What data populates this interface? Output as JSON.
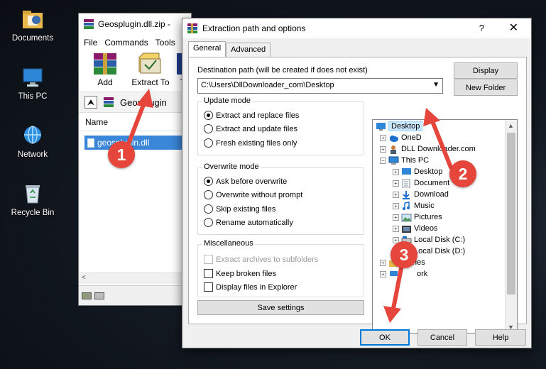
{
  "desktop": {
    "icons": [
      {
        "label": "Documents"
      },
      {
        "label": "This PC"
      },
      {
        "label": "Network"
      },
      {
        "label": "Recycle Bin"
      }
    ]
  },
  "winrar": {
    "title": "Geosplugin.dll.zip - ",
    "menu": [
      "File",
      "Commands",
      "Tools"
    ],
    "toolbar": {
      "add": "Add",
      "extract_to": "Extract To",
      "third": "T"
    },
    "address": "Geosplugin",
    "list_header": "Name",
    "selected_file": "geosplugin.dll"
  },
  "dialog": {
    "title": "Extraction path and options",
    "help": "?",
    "close": "✕",
    "tabs": [
      "General",
      "Advanced"
    ],
    "destination_label": "Destination path (will be created if does not exist)",
    "destination_value": "C:\\Users\\DllDownloader_com\\Desktop",
    "display_btn": "Display",
    "new_folder_btn": "New Folder",
    "update_mode": {
      "title": "Update mode",
      "options": [
        "Extract and replace files",
        "Extract and update files",
        "Fresh existing files only"
      ],
      "selected": 0
    },
    "overwrite_mode": {
      "title": "Overwrite mode",
      "options": [
        "Ask before overwrite",
        "Overwrite without prompt",
        "Skip existing files",
        "Rename automatically"
      ],
      "selected": 0
    },
    "misc": {
      "title": "Miscellaneous",
      "options": [
        "Extract archives to subfolders",
        "Keep broken files",
        "Display files in Explorer"
      ]
    },
    "save_settings": "Save settings",
    "tree": {
      "items": [
        {
          "label": "Desktop",
          "icon": "desktop-icon",
          "selected": true
        },
        {
          "label": "OneD",
          "icon": "onedrive-icon"
        },
        {
          "label": "DLL Downloader.com",
          "icon": "user-icon"
        },
        {
          "label": "This PC",
          "icon": "computer-icon"
        },
        {
          "label": "Desktop",
          "icon": "desktop-icon"
        },
        {
          "label": "Document",
          "icon": "documents-icon"
        },
        {
          "label": "Download",
          "icon": "download-icon"
        },
        {
          "label": "Music",
          "icon": "music-icon"
        },
        {
          "label": "Pictures",
          "icon": "pictures-icon"
        },
        {
          "label": "Videos",
          "icon": "videos-icon"
        },
        {
          "label": "Local Disk (C:)",
          "icon": "drive-icon"
        },
        {
          "label": "Local Disk (D:)",
          "icon": "drive-icon"
        },
        {
          "label": "ries",
          "icon": "folder-icon"
        },
        {
          "label": "ork",
          "icon": "network-icon"
        }
      ]
    },
    "ok": "OK",
    "cancel": "Cancel",
    "help_btn": "Help"
  },
  "annotations": {
    "markers": [
      "1",
      "2",
      "3"
    ],
    "color": "#e5453a"
  }
}
